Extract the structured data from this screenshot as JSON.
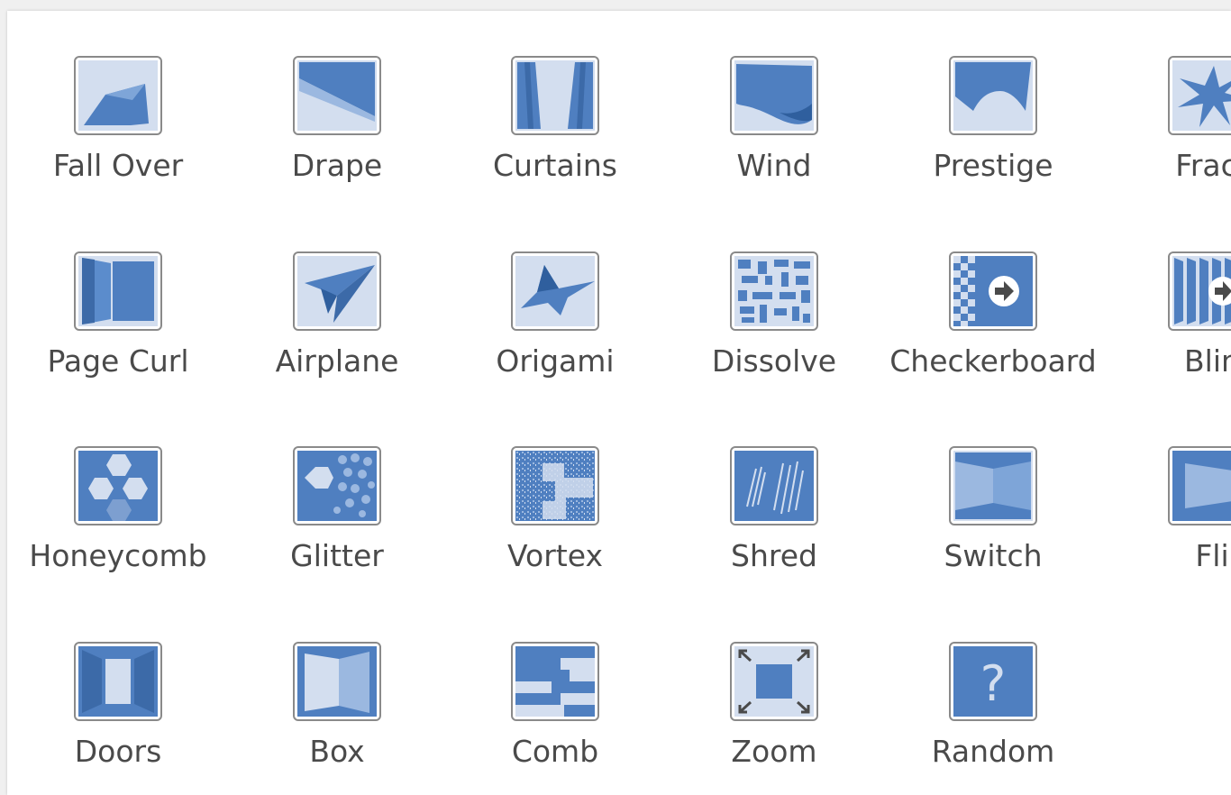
{
  "transitions": [
    {
      "label": "Fall Over",
      "icon": "fall-over-icon"
    },
    {
      "label": "Drape",
      "icon": "drape-icon"
    },
    {
      "label": "Curtains",
      "icon": "curtains-icon"
    },
    {
      "label": "Wind",
      "icon": "wind-icon"
    },
    {
      "label": "Prestige",
      "icon": "prestige-icon"
    },
    {
      "label": "Fract",
      "icon": "fracture-icon"
    },
    {
      "label": "Page Curl",
      "icon": "page-curl-icon"
    },
    {
      "label": "Airplane",
      "icon": "airplane-icon"
    },
    {
      "label": "Origami",
      "icon": "origami-icon"
    },
    {
      "label": "Dissolve",
      "icon": "dissolve-icon"
    },
    {
      "label": "Checkerboard",
      "icon": "checkerboard-icon"
    },
    {
      "label": "Blin",
      "icon": "blinds-icon"
    },
    {
      "label": "Honeycomb",
      "icon": "honeycomb-icon"
    },
    {
      "label": "Glitter",
      "icon": "glitter-icon"
    },
    {
      "label": "Vortex",
      "icon": "vortex-icon"
    },
    {
      "label": "Shred",
      "icon": "shred-icon"
    },
    {
      "label": "Switch",
      "icon": "switch-icon"
    },
    {
      "label": "Fli",
      "icon": "flip-icon"
    },
    {
      "label": "Doors",
      "icon": "doors-icon"
    },
    {
      "label": "Box",
      "icon": "box-icon"
    },
    {
      "label": "Comb",
      "icon": "comb-icon"
    },
    {
      "label": "Zoom",
      "icon": "zoom-icon"
    },
    {
      "label": "Random",
      "icon": "random-icon"
    }
  ],
  "colors": {
    "icon_bg": "#d3deef",
    "icon_fill": "#4f7fc0",
    "icon_dark": "#2f5f9e",
    "border": "#8a8a8a",
    "label": "#4a4a4a"
  }
}
